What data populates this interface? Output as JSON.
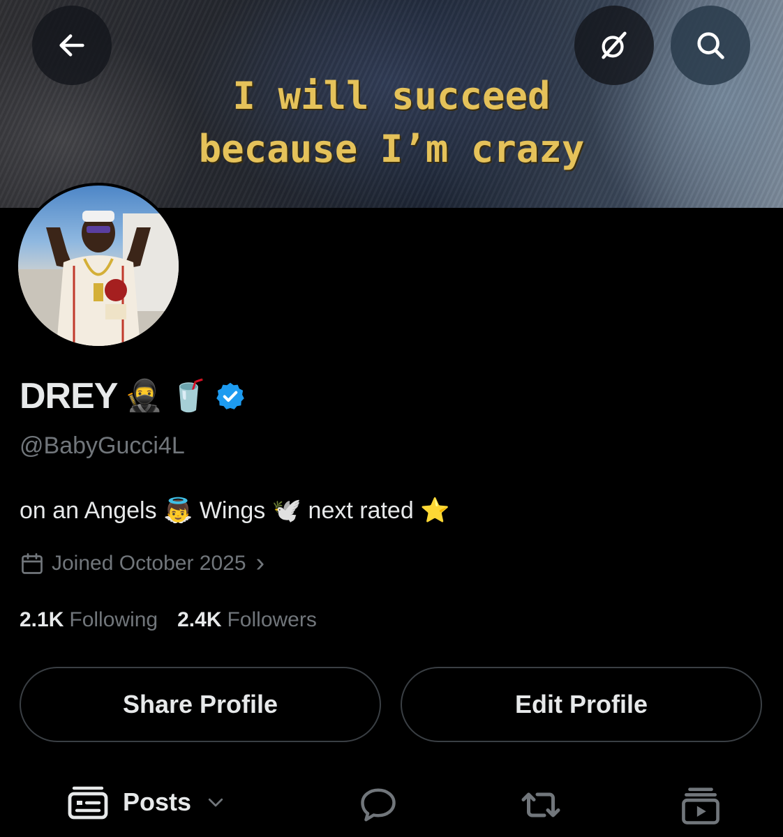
{
  "banner": {
    "caption_line1": "I will succeed",
    "caption_line2": "because I’m crazy"
  },
  "header": {
    "back_icon": "arrow-left-icon",
    "grok_icon": "grok-icon",
    "search_icon": "search-icon"
  },
  "profile": {
    "name": "DREY",
    "name_emoji_1": "🥷",
    "name_emoji_2": "🥤",
    "verified_color": "#1d9bf0",
    "handle": "@BabyGucci4L",
    "bio": "on an Angels 👼 Wings 🕊️ next rated ⭐",
    "joined": "Joined October 2025",
    "joined_chevron": "›"
  },
  "stats": {
    "following_count": "2.1K",
    "following_label": "Following",
    "followers_count": "2.4K",
    "followers_label": "Followers"
  },
  "actions": {
    "share_label": "Share Profile",
    "edit_label": "Edit Profile"
  },
  "tabs": {
    "posts_label": "Posts",
    "posts_icon": "posts-feed-icon",
    "replies_icon": "reply-bubble-icon",
    "reposts_icon": "repost-icon",
    "media_icon": "media-play-icon"
  },
  "colors": {
    "background": "#000000",
    "text_primary": "#e7e9ea",
    "text_secondary": "#71767b",
    "caption_gold": "#e5c25a"
  }
}
